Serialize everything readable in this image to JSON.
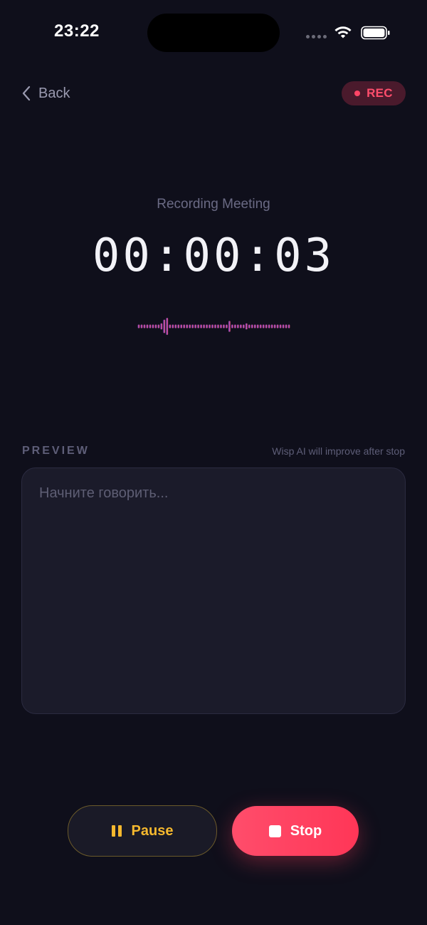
{
  "status_bar": {
    "time": "23:22",
    "icons": [
      "signal-dots-icon",
      "wifi-icon",
      "battery-icon"
    ]
  },
  "top_bar": {
    "back_label": "Back",
    "back_icon": "chevron-left-icon",
    "rec_label": "REC",
    "rec_color": "#ff4e6c"
  },
  "recording": {
    "mode_label": "Recording Meeting",
    "timer": "00:00:03"
  },
  "waveform": {
    "colors": [
      "#8a4bd1",
      "#e0507a"
    ],
    "levels": [
      0.15,
      0.15,
      0.15,
      0.15,
      0.15,
      0.15,
      0.15,
      0.15,
      0.25,
      0.55,
      0.7,
      0.15,
      0.15,
      0.15,
      0.15,
      0.15,
      0.15,
      0.15,
      0.15,
      0.15,
      0.15,
      0.15,
      0.15,
      0.15,
      0.15,
      0.15,
      0.15,
      0.15,
      0.15,
      0.15,
      0.15,
      0.15,
      0.45,
      0.15,
      0.15,
      0.15,
      0.15,
      0.15,
      0.25,
      0.15,
      0.15,
      0.15,
      0.15,
      0.15,
      0.15,
      0.15,
      0.15,
      0.15,
      0.15,
      0.15,
      0.15,
      0.15,
      0.15,
      0.15
    ]
  },
  "preview": {
    "title": "PREVIEW",
    "hint": "Wisp AI will improve after stop",
    "placeholder": "Начните говорить..."
  },
  "controls": {
    "pause_label": "Pause",
    "stop_label": "Stop",
    "pause_color": "#f5b82e",
    "stop_color": "#ff4566"
  }
}
